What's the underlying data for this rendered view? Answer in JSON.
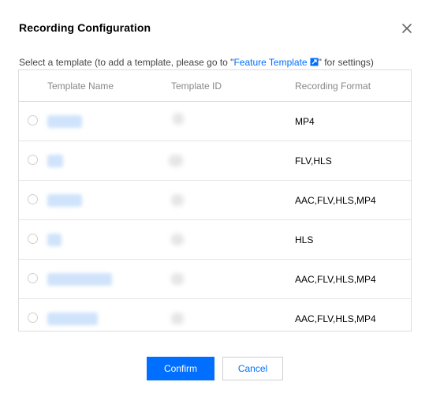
{
  "dialog": {
    "title": "Recording Configuration",
    "close_icon": "close-icon"
  },
  "instruction": {
    "prefix": "Select a template (to add a template, please go to \"",
    "link_text": "Feature Template",
    "link_icon": "external-link-icon",
    "suffix": "\" for settings)"
  },
  "table": {
    "headers": {
      "name": "Template Name",
      "id": "Template ID",
      "format": "Recording Format"
    },
    "rows": [
      {
        "format": "MP4"
      },
      {
        "format": "FLV,HLS"
      },
      {
        "format": "AAC,FLV,HLS,MP4"
      },
      {
        "format": "HLS"
      },
      {
        "format": "AAC,FLV,HLS,MP4"
      },
      {
        "format": "AAC,FLV,HLS,MP4"
      }
    ]
  },
  "footer": {
    "confirm_label": "Confirm",
    "cancel_label": "Cancel"
  },
  "colors": {
    "accent": "#006eff",
    "border": "#dddddd",
    "header_text": "#888888"
  }
}
